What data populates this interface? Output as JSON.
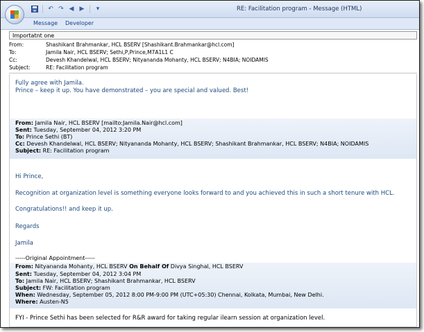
{
  "window": {
    "title": "RE: Facilitation program - Message (HTML)"
  },
  "ribbon": {
    "tabs": [
      "Message",
      "Developer"
    ]
  },
  "infobar": {
    "text": "Importatnt one"
  },
  "header": {
    "from_label": "From:",
    "from_value": "Shashikant Brahmankar, HCL BSERV [Shashikant.Brahmankar@hcl.com]",
    "to_label": "To:",
    "to_value": "Jamila Nair, HCL BSERV; Sethi,P,Prince,M7A1L1 C",
    "cc_label": "Cc:",
    "cc_value": "Devesh Khandelwal, HCL BSERV; Nityananda Mohanty, HCL BSERV; N4BIA; NOIDAMIS",
    "subject_label": "Subject:",
    "subject_value": "RE: Facilitation program"
  },
  "reply": {
    "line1": "Fully agree with Jamila.",
    "line2": "Prince – keep it up. You have demonstrated – you are special and valued. Best!"
  },
  "quoted1": {
    "from_label": "From:",
    "from_value": "Jamila Nair, HCL BSERV [mailto:Jamila.Nair@hcl.com]",
    "sent_label": "Sent:",
    "sent_value": "Tuesday, September 04, 2012 3:20 PM",
    "to_label": "To:",
    "to_value": "Prince Sethi (BT)",
    "cc_label": "Cc:",
    "cc_value": "Devesh Khandelwal, HCL BSERV; Nityananda Mohanty, HCL BSERV; Shashikant Brahmankar, HCL BSERV; N4BIA; NOIDAMIS",
    "subject_label": "Subject:",
    "subject_value": "RE: Facilitation program",
    "greeting": "Hi Prince,",
    "para1": "Recognition at organization level is something everyone looks forward to and you achieved this in such a short tenure with HCL.",
    "para2": "Congratulations!! and keep it up.",
    "regards": "Regards",
    "signature": "Jamila"
  },
  "quoted2": {
    "separator": "-----Original Appointment-----",
    "from_label": "From:",
    "from_value": "Nityananda Mohanty, HCL BSERV",
    "behalf_label": "On Behalf Of",
    "behalf_value": "Divya Singhal, HCL BSERV",
    "sent_label": "Sent:",
    "sent_value": "Tuesday, September 04, 2012 3:04 PM",
    "to_label": "To:",
    "to_value": "Jamila Nair, HCL BSERV; Shashikant Brahmankar, HCL BSERV",
    "subject_label": "Subject:",
    "subject_value": "FW: Facilitation program",
    "when_label": "When:",
    "when_value": "Wednesday, September 05, 2012 8:00 PM-9:00 PM (UTC+05:30) Chennai, Kolkata, Mumbai, New Delhi.",
    "where_label": "Where:",
    "where_value": "Austen-N5",
    "fyi": "FYI - Prince Sethi has been selected for R&R award for taking regular ilearn session at organization level."
  },
  "colors": {
    "body_text": "#1f497d",
    "ribbon_text": "#15428b"
  }
}
